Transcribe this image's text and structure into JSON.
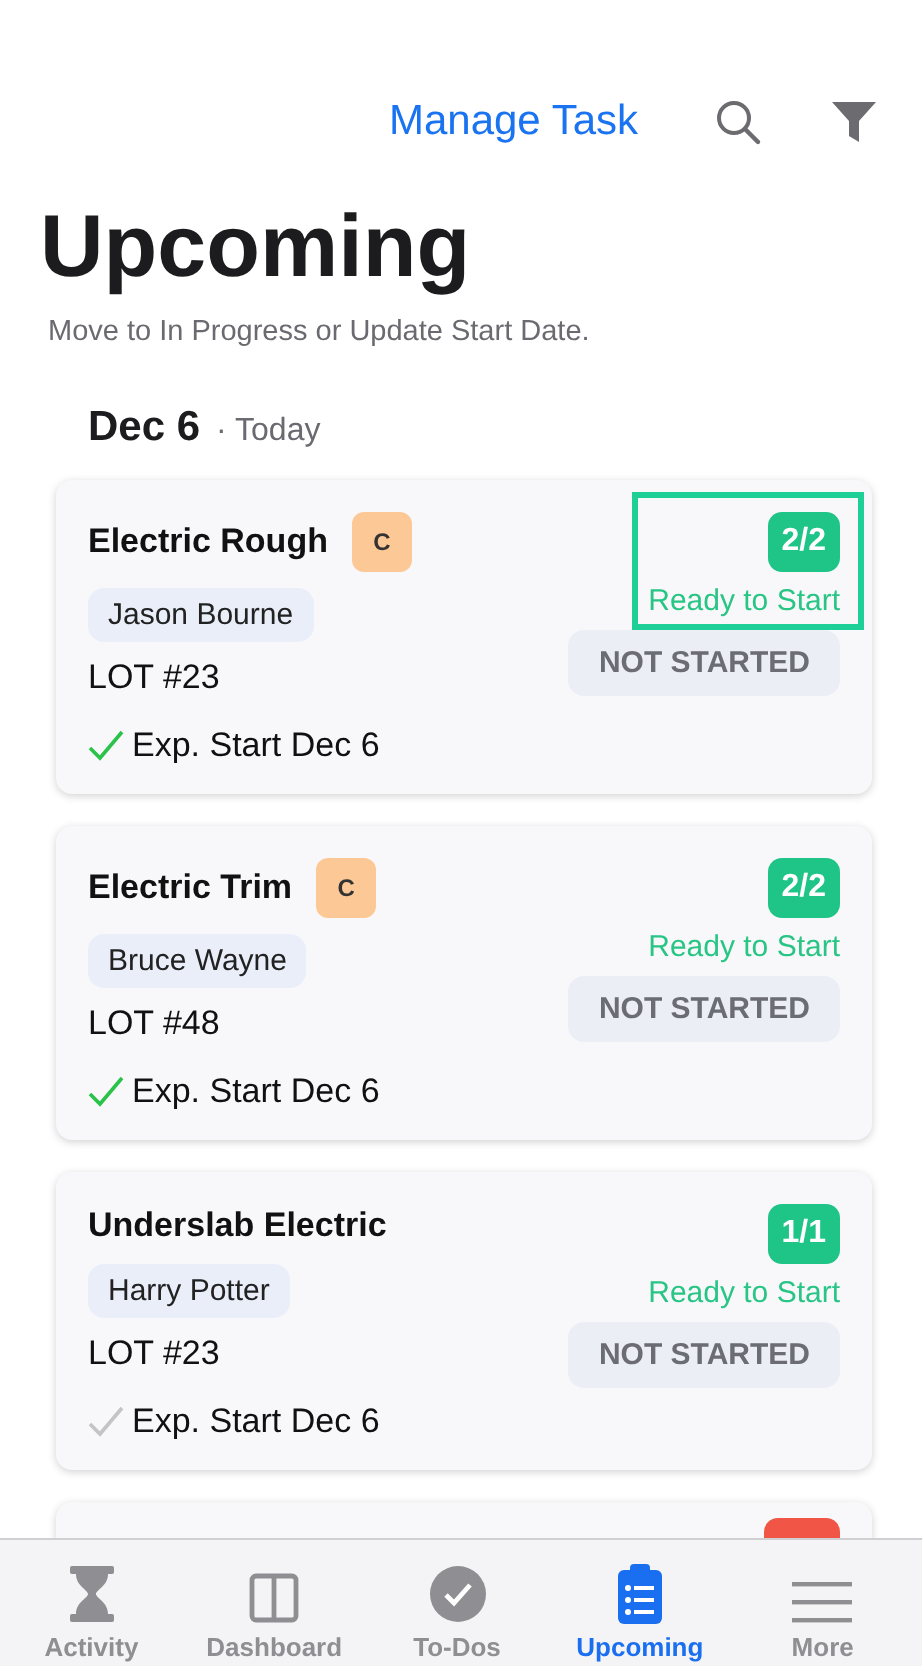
{
  "header": {
    "action": "Manage Task"
  },
  "title": "Upcoming",
  "subtitle": "Move to In Progress or Update Start Date.",
  "section": {
    "date": "Dec 6",
    "note": "· Today"
  },
  "cards": [
    {
      "title": "Electric Rough",
      "role": "C",
      "assignee": "Jason Bourne",
      "lot": "LOT #23",
      "count": "2/2",
      "readiness": "Ready to Start",
      "status": "NOT STARTED",
      "start": "Exp. Start Dec 6",
      "confirmed": true,
      "highlighted": true
    },
    {
      "title": "Electric Trim",
      "role": "C",
      "assignee": "Bruce Wayne",
      "lot": "LOT #48",
      "count": "2/2",
      "readiness": "Ready to Start",
      "status": "NOT STARTED",
      "start": "Exp. Start Dec 6",
      "confirmed": true,
      "highlighted": false
    },
    {
      "title": "Underslab Electric",
      "assignee": "Harry Potter",
      "lot": "LOT #23",
      "count": "1/1",
      "readiness": "Ready to Start",
      "status": "NOT STARTED",
      "start": "Exp. Start Dec 6",
      "confirmed": false,
      "highlighted": false
    }
  ],
  "tabs": [
    {
      "label": "Activity",
      "kind": "hourglass",
      "selected": false
    },
    {
      "label": "Dashboard",
      "kind": "columns",
      "selected": false
    },
    {
      "label": "To-Dos",
      "kind": "check",
      "selected": false
    },
    {
      "label": "Upcoming",
      "kind": "clipboard",
      "selected": true
    },
    {
      "label": "More",
      "kind": "menu",
      "selected": false
    }
  ]
}
